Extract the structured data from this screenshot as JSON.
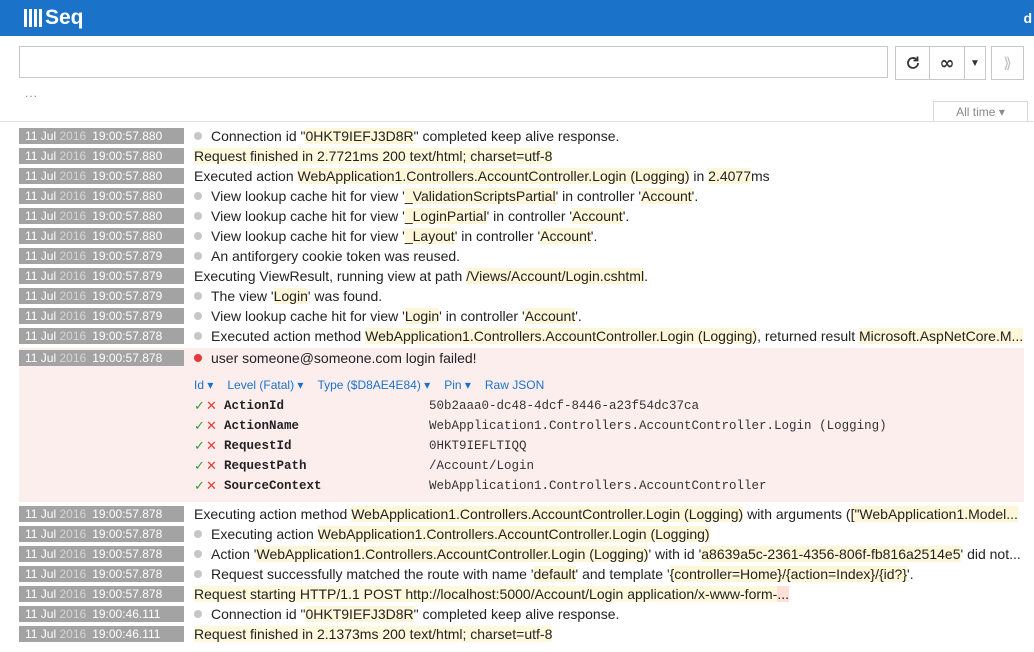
{
  "app": {
    "logo_text": "Seq",
    "user_initial": "d"
  },
  "search": {
    "value": "",
    "placeholder": ""
  },
  "toolbar": {
    "refresh_icon": "refresh-icon",
    "tail_icon": "infinity-icon",
    "dropdown_icon": "caret-down-icon",
    "expand_icon": "double-chevron-right-icon"
  },
  "filter_ellipsis": "...",
  "range": {
    "label": "All time ▾"
  },
  "events_before": [
    {
      "day": "11 Jul",
      "year": "2016",
      "time": "19:00:57.880",
      "dot": true,
      "bg": false,
      "parts": [
        [
          "Connection id \"",
          ""
        ],
        [
          "0HKT9IEFJ3D8R",
          "hl"
        ],
        [
          "\" completed keep alive response.",
          ""
        ]
      ]
    },
    {
      "day": "11 Jul",
      "year": "2016",
      "time": "19:00:57.880",
      "dot": false,
      "bg": true,
      "parts": [
        [
          "Request finished in 2.7721ms 200 text/html; charset=utf-8",
          ""
        ]
      ]
    },
    {
      "day": "11 Jul",
      "year": "2016",
      "time": "19:00:57.880",
      "dot": false,
      "bg": false,
      "parts": [
        [
          "Executed action ",
          ""
        ],
        [
          "WebApplication1.Controllers.AccountController.Login (Logging)",
          "hl"
        ],
        [
          " in ",
          ""
        ],
        [
          "2.4077",
          "hl"
        ],
        [
          "ms",
          ""
        ]
      ]
    },
    {
      "day": "11 Jul",
      "year": "2016",
      "time": "19:00:57.880",
      "dot": true,
      "bg": false,
      "parts": [
        [
          "View lookup cache hit for view '",
          ""
        ],
        [
          "_ValidationScriptsPartial",
          "hl"
        ],
        [
          "' in controller '",
          ""
        ],
        [
          "Account",
          "hl"
        ],
        [
          "'.",
          ""
        ]
      ]
    },
    {
      "day": "11 Jul",
      "year": "2016",
      "time": "19:00:57.880",
      "dot": true,
      "bg": false,
      "parts": [
        [
          "View lookup cache hit for view '",
          ""
        ],
        [
          "_LoginPartial",
          "hl"
        ],
        [
          "' in controller '",
          ""
        ],
        [
          "Account",
          "hl"
        ],
        [
          "'.",
          ""
        ]
      ]
    },
    {
      "day": "11 Jul",
      "year": "2016",
      "time": "19:00:57.880",
      "dot": true,
      "bg": false,
      "parts": [
        [
          "View lookup cache hit for view '",
          ""
        ],
        [
          "_Layout",
          "hl"
        ],
        [
          "' in controller '",
          ""
        ],
        [
          "Account",
          "hl"
        ],
        [
          "'.",
          ""
        ]
      ]
    },
    {
      "day": "11 Jul",
      "year": "2016",
      "time": "19:00:57.879",
      "dot": true,
      "bg": false,
      "parts": [
        [
          "An antiforgery cookie token was reused.",
          ""
        ]
      ]
    },
    {
      "day": "11 Jul",
      "year": "2016",
      "time": "19:00:57.879",
      "dot": false,
      "bg": false,
      "parts": [
        [
          "Executing ViewResult, running view at path ",
          ""
        ],
        [
          "/Views/Account/Login.cshtml",
          "hl"
        ],
        [
          ".",
          ""
        ]
      ]
    },
    {
      "day": "11 Jul",
      "year": "2016",
      "time": "19:00:57.879",
      "dot": true,
      "bg": false,
      "parts": [
        [
          "The view '",
          ""
        ],
        [
          "Login",
          "hl"
        ],
        [
          "' was found.",
          ""
        ]
      ]
    },
    {
      "day": "11 Jul",
      "year": "2016",
      "time": "19:00:57.879",
      "dot": true,
      "bg": false,
      "parts": [
        [
          "View lookup cache hit for view '",
          ""
        ],
        [
          "Login",
          "hl"
        ],
        [
          "' in controller '",
          ""
        ],
        [
          "Account",
          "hl"
        ],
        [
          "'.",
          ""
        ]
      ]
    },
    {
      "day": "11 Jul",
      "year": "2016",
      "time": "19:00:57.878",
      "dot": true,
      "bg": false,
      "parts": [
        [
          "Executed action method ",
          ""
        ],
        [
          "WebApplication1.Controllers.AccountController.Login (Logging)",
          "hl"
        ],
        [
          ", returned result ",
          ""
        ],
        [
          "Microsoft.AspNetCore.M...",
          "hl"
        ]
      ]
    }
  ],
  "selected_event": {
    "day": "11 Jul",
    "year": "2016",
    "time": "19:00:57.878",
    "message": "user someone@someone.com login failed!",
    "links": [
      "Id ▾",
      "Level (Fatal) ▾",
      "Type ($D8AE4E84) ▾",
      "Pin ▾",
      "Raw JSON"
    ],
    "properties": [
      {
        "name": "ActionId",
        "value": "50b2aaa0-dc48-4dcf-8446-a23f54dc37ca"
      },
      {
        "name": "ActionName",
        "value": "WebApplication1.Controllers.AccountController.Login (Logging)"
      },
      {
        "name": "RequestId",
        "value": "0HKT9IEFLTIQQ"
      },
      {
        "name": "RequestPath",
        "value": "/Account/Login"
      },
      {
        "name": "SourceContext",
        "value": "WebApplication1.Controllers.AccountController"
      }
    ]
  },
  "events_after": [
    {
      "day": "11 Jul",
      "year": "2016",
      "time": "19:00:57.878",
      "dot": false,
      "bg": false,
      "parts": [
        [
          "Executing action method ",
          ""
        ],
        [
          "WebApplication1.Controllers.AccountController.Login (Logging)",
          "hl"
        ],
        [
          " with arguments (",
          ""
        ],
        [
          "[\"WebApplication1.Model...",
          "hl"
        ]
      ]
    },
    {
      "day": "11 Jul",
      "year": "2016",
      "time": "19:00:57.878",
      "dot": true,
      "bg": false,
      "parts": [
        [
          "Executing action ",
          ""
        ],
        [
          "WebApplication1.Controllers.AccountController.Login (Logging)",
          "hl"
        ]
      ]
    },
    {
      "day": "11 Jul",
      "year": "2016",
      "time": "19:00:57.878",
      "dot": true,
      "bg": false,
      "parts": [
        [
          "Action '",
          ""
        ],
        [
          "WebApplication1.Controllers.AccountController.Login (Logging)",
          "hl"
        ],
        [
          "' with id '",
          ""
        ],
        [
          "a8639a5c-2361-4356-806f-fb816a2514e5",
          "hl"
        ],
        [
          "' did not...",
          ""
        ]
      ]
    },
    {
      "day": "11 Jul",
      "year": "2016",
      "time": "19:00:57.878",
      "dot": true,
      "bg": false,
      "parts": [
        [
          "Request successfully matched the route with name '",
          ""
        ],
        [
          "default",
          "hl"
        ],
        [
          "' and template '",
          ""
        ],
        [
          "{controller=Home}/{action=Index}/{id?}",
          "hl"
        ],
        [
          "'.",
          ""
        ]
      ]
    },
    {
      "day": "11 Jul",
      "year": "2016",
      "time": "19:00:57.878",
      "dot": false,
      "bg": true,
      "parts": [
        [
          "Request starting HTTP/1.1 POST http://localhost:5000/Account/Login application/x-www-form-",
          ""
        ],
        [
          "...",
          "hlred"
        ]
      ]
    },
    {
      "day": "11 Jul",
      "year": "2016",
      "time": "19:00:46.111",
      "dot": true,
      "bg": false,
      "parts": [
        [
          "Connection id \"",
          ""
        ],
        [
          "0HKT9IEFJ3D8R",
          "hl"
        ],
        [
          "\" completed keep alive response.",
          ""
        ]
      ]
    },
    {
      "day": "11 Jul",
      "year": "2016",
      "time": "19:00:46.111",
      "dot": false,
      "bg": true,
      "parts": [
        [
          "Request finished in 2.1373ms 200 text/html; charset=utf-8",
          ""
        ]
      ]
    }
  ]
}
